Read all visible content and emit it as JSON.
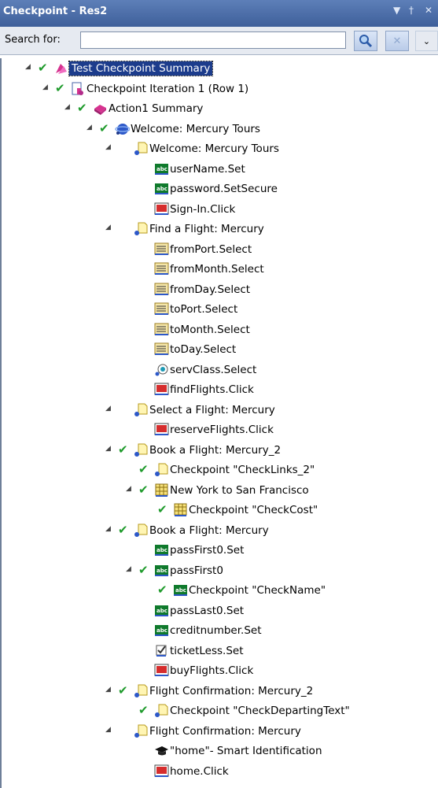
{
  "window": {
    "title": "Checkpoint - Res2",
    "pin_icon": "pin-icon",
    "close_icon": "close-icon"
  },
  "search": {
    "label": "Search for:",
    "value": "",
    "placeholder": ""
  },
  "tree": {
    "rows": [
      {
        "label": "Test Checkpoint Summary",
        "depth": 0,
        "check": true,
        "expander": true,
        "icon": "summary-icon",
        "selected": true
      },
      {
        "label": "Checkpoint Iteration 1 (Row 1)",
        "depth": 1,
        "check": true,
        "expander": true,
        "icon": "iteration-icon"
      },
      {
        "label": "Action1 Summary",
        "depth": 2,
        "check": true,
        "expander": true,
        "icon": "action-icon"
      },
      {
        "label": "Welcome: Mercury Tours",
        "depth": 3,
        "check": true,
        "expander": true,
        "icon": "browser-icon"
      },
      {
        "label": "Welcome: Mercury Tours",
        "depth": 4,
        "check": false,
        "expander": true,
        "icon": "page-icon"
      },
      {
        "label": "userName.Set",
        "depth": 5,
        "check": false,
        "expander": false,
        "icon": "edit-field-icon"
      },
      {
        "label": "password.SetSecure",
        "depth": 5,
        "check": false,
        "expander": false,
        "icon": "edit-field-icon"
      },
      {
        "label": "Sign-In.Click",
        "depth": 5,
        "check": false,
        "expander": false,
        "icon": "image-button-icon"
      },
      {
        "label": "Find a Flight: Mercury",
        "depth": 4,
        "check": false,
        "expander": true,
        "icon": "page-icon"
      },
      {
        "label": "fromPort.Select",
        "depth": 5,
        "check": false,
        "expander": false,
        "icon": "list-icon"
      },
      {
        "label": "fromMonth.Select",
        "depth": 5,
        "check": false,
        "expander": false,
        "icon": "list-icon"
      },
      {
        "label": "fromDay.Select",
        "depth": 5,
        "check": false,
        "expander": false,
        "icon": "list-icon"
      },
      {
        "label": "toPort.Select",
        "depth": 5,
        "check": false,
        "expander": false,
        "icon": "list-icon"
      },
      {
        "label": "toMonth.Select",
        "depth": 5,
        "check": false,
        "expander": false,
        "icon": "list-icon"
      },
      {
        "label": "toDay.Select",
        "depth": 5,
        "check": false,
        "expander": false,
        "icon": "list-icon"
      },
      {
        "label": "servClass.Select",
        "depth": 5,
        "check": false,
        "expander": false,
        "icon": "radio-group-icon"
      },
      {
        "label": "findFlights.Click",
        "depth": 5,
        "check": false,
        "expander": false,
        "icon": "image-button-icon"
      },
      {
        "label": "Select a Flight: Mercury",
        "depth": 4,
        "check": false,
        "expander": true,
        "icon": "page-icon"
      },
      {
        "label": "reserveFlights.Click",
        "depth": 5,
        "check": false,
        "expander": false,
        "icon": "image-button-icon"
      },
      {
        "label": "Book a Flight: Mercury_2",
        "depth": 4,
        "check": true,
        "expander": true,
        "icon": "page-icon"
      },
      {
        "label": "Checkpoint \"CheckLinks_2\"",
        "depth": 5,
        "check": true,
        "expander": false,
        "icon": "page-icon"
      },
      {
        "label": "New York to San Francisco",
        "depth": 5,
        "check": true,
        "expander": true,
        "icon": "table-icon"
      },
      {
        "label": "Checkpoint \"CheckCost\"",
        "depth": 6,
        "check": true,
        "expander": false,
        "icon": "table-icon"
      },
      {
        "label": "Book a Flight: Mercury",
        "depth": 4,
        "check": true,
        "expander": true,
        "icon": "page-icon"
      },
      {
        "label": "passFirst0.Set",
        "depth": 5,
        "check": false,
        "expander": false,
        "icon": "edit-field-icon"
      },
      {
        "label": "passFirst0",
        "depth": 5,
        "check": true,
        "expander": true,
        "icon": "edit-field-icon"
      },
      {
        "label": "Checkpoint \"CheckName\"",
        "depth": 6,
        "check": true,
        "expander": false,
        "icon": "edit-field-icon"
      },
      {
        "label": "passLast0.Set",
        "depth": 5,
        "check": false,
        "expander": false,
        "icon": "edit-field-icon"
      },
      {
        "label": "creditnumber.Set",
        "depth": 5,
        "check": false,
        "expander": false,
        "icon": "edit-field-icon"
      },
      {
        "label": "ticketLess.Set",
        "depth": 5,
        "check": false,
        "expander": false,
        "icon": "checkbox-icon"
      },
      {
        "label": "buyFlights.Click",
        "depth": 5,
        "check": false,
        "expander": false,
        "icon": "image-button-icon"
      },
      {
        "label": "Flight Confirmation: Mercury_2",
        "depth": 4,
        "check": true,
        "expander": true,
        "icon": "page-icon"
      },
      {
        "label": "Checkpoint \"CheckDepartingText\"",
        "depth": 5,
        "check": true,
        "expander": false,
        "icon": "page-icon"
      },
      {
        "label": "Flight Confirmation: Mercury",
        "depth": 4,
        "check": false,
        "expander": true,
        "icon": "page-icon"
      },
      {
        "label": "\"home\"- Smart Identification",
        "depth": 5,
        "check": false,
        "expander": false,
        "icon": "smart-id-icon"
      },
      {
        "label": "home.Click",
        "depth": 5,
        "check": false,
        "expander": false,
        "icon": "image-button-icon"
      }
    ]
  }
}
